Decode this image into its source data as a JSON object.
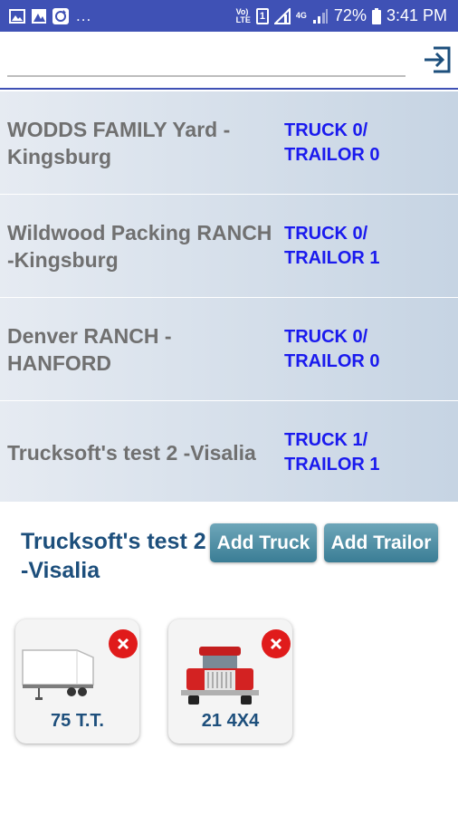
{
  "status_bar": {
    "dots": "...",
    "volte_top": "Vo)",
    "volte_bottom": "LTE",
    "sim_label": "1",
    "network_top": "4G",
    "battery": "72%",
    "time": "3:41 PM",
    "icons": [
      "gallery-icon",
      "photos-icon",
      "sync-icon",
      "volte-icon",
      "sim-icon",
      "signal-icon",
      "network-4g-icon",
      "signal-bars-icon",
      "battery-icon"
    ]
  },
  "search": {
    "value": "",
    "placeholder": ""
  },
  "logout": {
    "icon": "logout-icon"
  },
  "yards": [
    {
      "name": "WODDS FAMILY Yard - Kingsburg",
      "truck": "TRUCK 0/",
      "trailor": "TRAILOR 0"
    },
    {
      "name": "Wildwood Packing RANCH -Kingsburg",
      "truck": "TRUCK 0/",
      "trailor": "TRAILOR 1"
    },
    {
      "name": "Denver RANCH - HANFORD",
      "truck": "TRUCK 0/",
      "trailor": "TRAILOR 0"
    },
    {
      "name": "Trucksoft's test 2 -Visalia",
      "truck": "TRUCK 1/",
      "trailor": "TRAILOR 1"
    }
  ],
  "detail": {
    "title": "Trucksoft's test 2 -Visalia",
    "add_truck_label": "Add Truck",
    "add_trailor_label": "Add Trailor"
  },
  "vehicles": [
    {
      "label": "75 T.T.",
      "icon": "trailer-icon",
      "remove_icon": "close-icon"
    },
    {
      "label": "21 4X4",
      "icon": "truck-icon",
      "remove_icon": "close-icon"
    }
  ],
  "colors": {
    "status_bar": "#3f51b5",
    "counts_text": "#1a1aee",
    "yard_name_text": "#707070",
    "title_text": "#1d4f7c",
    "button": "#4a8ca3",
    "remove": "#e01b1b"
  }
}
